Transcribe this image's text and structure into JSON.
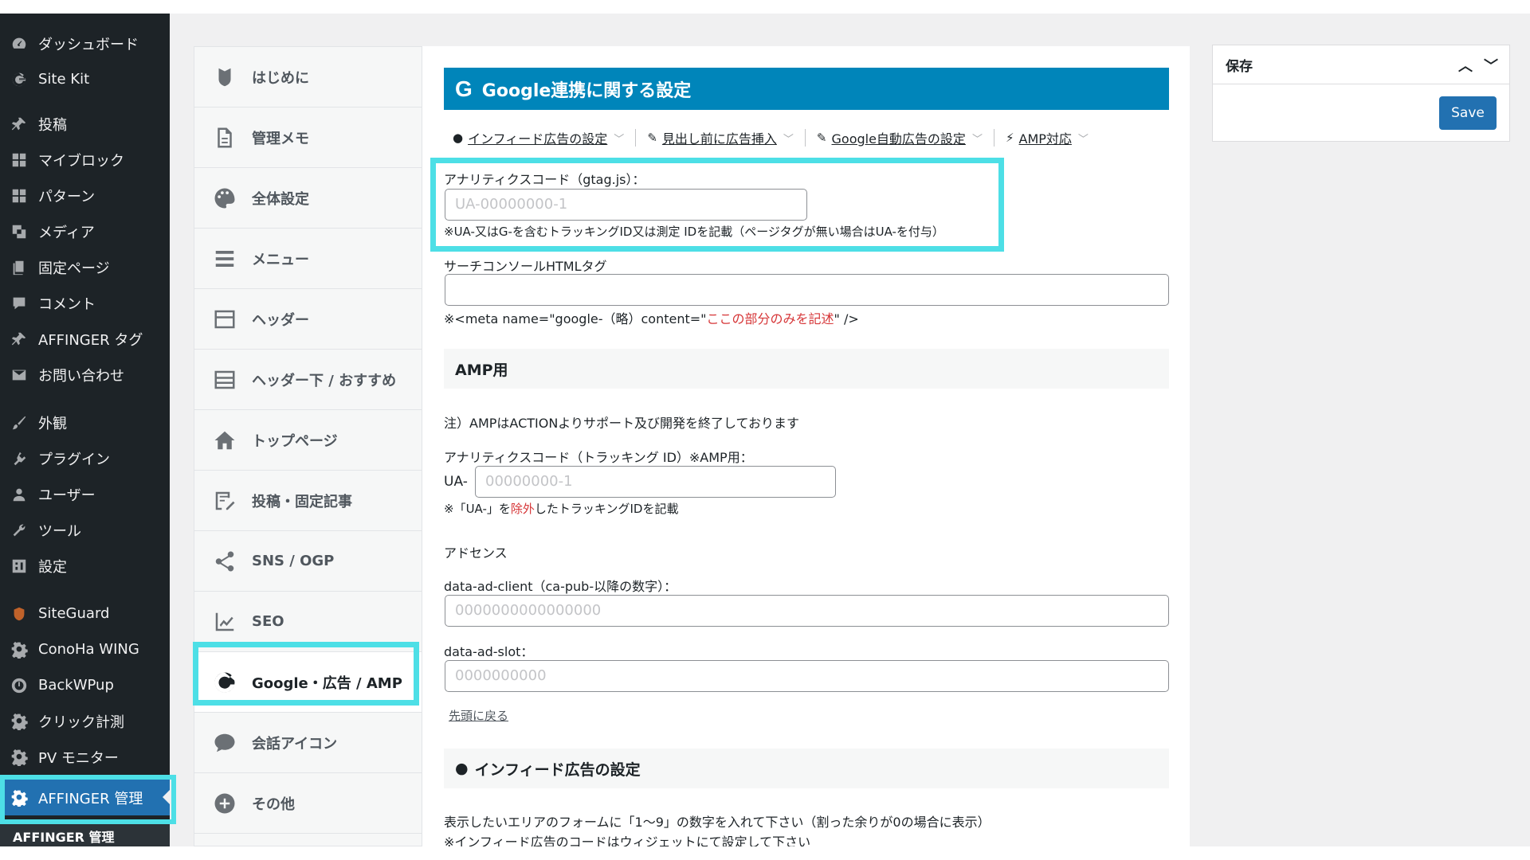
{
  "wp_menu": {
    "items": [
      {
        "label": "ダッシュボード",
        "icon": "dashboard-icon"
      },
      {
        "label": "Site Kit",
        "icon": "google-g-icon"
      },
      {
        "label": "投稿",
        "icon": "pin-icon"
      },
      {
        "label": "マイブロック",
        "icon": "grid-icon"
      },
      {
        "label": "パターン",
        "icon": "grid-icon"
      },
      {
        "label": "メディア",
        "icon": "media-icon"
      },
      {
        "label": "固定ページ",
        "icon": "page-icon"
      },
      {
        "label": "コメント",
        "icon": "comment-icon"
      },
      {
        "label": "AFFINGER タグ",
        "icon": "pin-icon"
      },
      {
        "label": "お問い合わせ",
        "icon": "mail-icon"
      },
      {
        "label": "外観",
        "icon": "brush-icon"
      },
      {
        "label": "プラグイン",
        "icon": "plugin-icon"
      },
      {
        "label": "ユーザー",
        "icon": "user-icon"
      },
      {
        "label": "ツール",
        "icon": "wrench-icon"
      },
      {
        "label": "設定",
        "icon": "settings-icon"
      },
      {
        "label": "SiteGuard",
        "icon": "shield-icon"
      },
      {
        "label": "ConoHa WING",
        "icon": "gear-icon"
      },
      {
        "label": "BackWPup",
        "icon": "backup-icon"
      },
      {
        "label": "クリック計測",
        "icon": "gear-icon"
      },
      {
        "label": "PV モニター",
        "icon": "gear-icon"
      },
      {
        "label": "AFFINGER 管理",
        "icon": "gear-icon"
      }
    ],
    "submenu_label": "AFFINGER 管理"
  },
  "aff_menu": {
    "items": [
      {
        "label": "はじめに",
        "icon": "leaf-icon"
      },
      {
        "label": "管理メモ",
        "icon": "memo-icon"
      },
      {
        "label": "全体設定",
        "icon": "palette-icon"
      },
      {
        "label": "メニュー",
        "icon": "menu-icon"
      },
      {
        "label": "ヘッダー",
        "icon": "header-icon"
      },
      {
        "label": "ヘッダー下 / おすすめ",
        "icon": "header-below-icon"
      },
      {
        "label": "トップページ",
        "icon": "home-icon"
      },
      {
        "label": "投稿・固定記事",
        "icon": "edit-icon"
      },
      {
        "label": "SNS / OGP",
        "icon": "share-icon"
      },
      {
        "label": "SEO",
        "icon": "chart-icon"
      },
      {
        "label": "Google・広告 / AMP",
        "icon": "google-g-icon"
      },
      {
        "label": "会話アイコン",
        "icon": "speech-icon"
      },
      {
        "label": "その他",
        "icon": "plus-circle-icon"
      }
    ]
  },
  "main": {
    "header_icon": "G",
    "header_title": "Google連携に関する設定",
    "subnav": [
      "インフィード広告の設定",
      "見出し前に広告挿入",
      "Google自動広告の設定",
      "AMP対応"
    ],
    "analytics_label": "アナリティクスコード（gtag.js）：",
    "analytics_placeholder": "UA-00000000-1",
    "analytics_note": "※UA-又はG-を含むトラッキングID又は測定 IDを記載（ページタグが無い場合はUA-を付与）",
    "search_console_label": "サーチコンソールHTMLタグ",
    "meta_note_prefix": "※<meta name=\"google-（略）content=\"",
    "meta_note_red": "ここの部分のみを記述",
    "meta_note_suffix": "\" />",
    "amp_section": "AMP用",
    "amp_notice": "注）AMPはACTIONよりサポート及び開発を終了しております",
    "amp_analytics_label": "アナリティクスコード（トラッキング ID）※AMP用：",
    "ua_prefix": "UA-",
    "amp_placeholder": "00000000-1",
    "amp_note_prefix": "※「UA-」を",
    "amp_note_red": "除外",
    "amp_note_suffix": "したトラッキングIDを記載",
    "adsense_label": "アドセンス",
    "ad_client_label": "data-ad-client（ca-pub-以降の数字）：",
    "ad_client_placeholder": "0000000000000000",
    "ad_slot_label": "data-ad-slot：",
    "ad_slot_placeholder": "0000000000",
    "back_to_top": "先頭に戻る",
    "infeed_section": "インフィード広告の設定",
    "infeed_note1": "表示したいエリアのフォームに「1〜9」の数字を入れて下さい（割った余りが0の場合に表示）",
    "infeed_note2": "※インフィード広告のコードはウィジェットにて設定して下さい"
  },
  "savebox": {
    "title": "保存",
    "button": "Save"
  }
}
